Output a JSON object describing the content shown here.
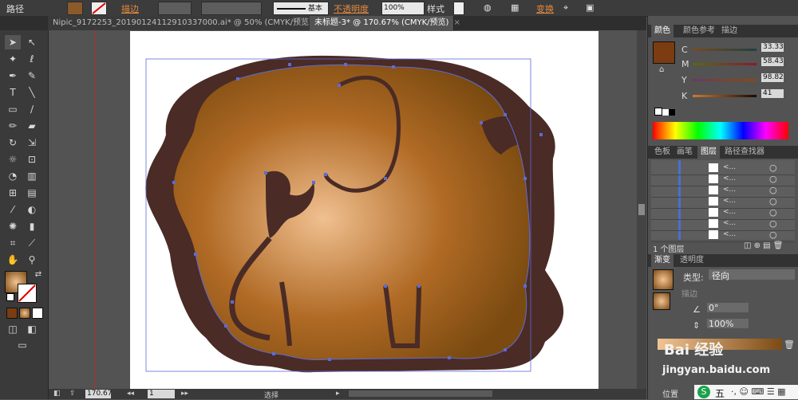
{
  "control_bar": {
    "mode_label": "路径",
    "stroke_label": "描边",
    "stroke_style": "基本",
    "opacity_label": "不透明度",
    "opacity_value": "100%",
    "style_label": "样式",
    "transform_label": "变换"
  },
  "tabs": [
    {
      "label": "Nipic_9172253_20190124112910337000.ai* @ 50% (CMYK/预览)",
      "active": false
    },
    {
      "label": "未标题-3* @ 170.67% (CMYK/预览)",
      "active": true
    }
  ],
  "color_panel": {
    "tabs": [
      "颜色",
      "颜色参考",
      "描边"
    ],
    "swatch_color": "#7a3c10",
    "channels": [
      {
        "name": "C",
        "value": "33.33"
      },
      {
        "name": "M",
        "value": "58.43"
      },
      {
        "name": "Y",
        "value": "98.82"
      },
      {
        "name": "K",
        "value": "41"
      }
    ]
  },
  "layers_panel": {
    "tabs": [
      "色板",
      "画笔",
      "图层",
      "路径查找器"
    ],
    "rows": [
      "<...",
      "<...",
      "<...",
      "<...",
      "<...",
      "<...",
      "<..."
    ],
    "footer": "1 个图层"
  },
  "gradient_panel": {
    "tabs": [
      "渐变",
      "透明度"
    ],
    "type_label": "类型:",
    "type_value": "径向",
    "stroke_label": "描边",
    "angle_value": "0°",
    "ratio_value": "100%",
    "position_label": "位置"
  },
  "status_bar": {
    "zoom": "170.67",
    "page": "1",
    "tool_name": "选择"
  },
  "watermark": {
    "logo": "Bai 经验",
    "url": "jingyan.baidu.com"
  },
  "ime": {
    "label": "五"
  },
  "colors": {
    "elephant_outline": "#4a2b25",
    "gradient_center": "#f0c090",
    "gradient_edge": "#7a4a10",
    "path_blue": "#5c6bd6"
  }
}
